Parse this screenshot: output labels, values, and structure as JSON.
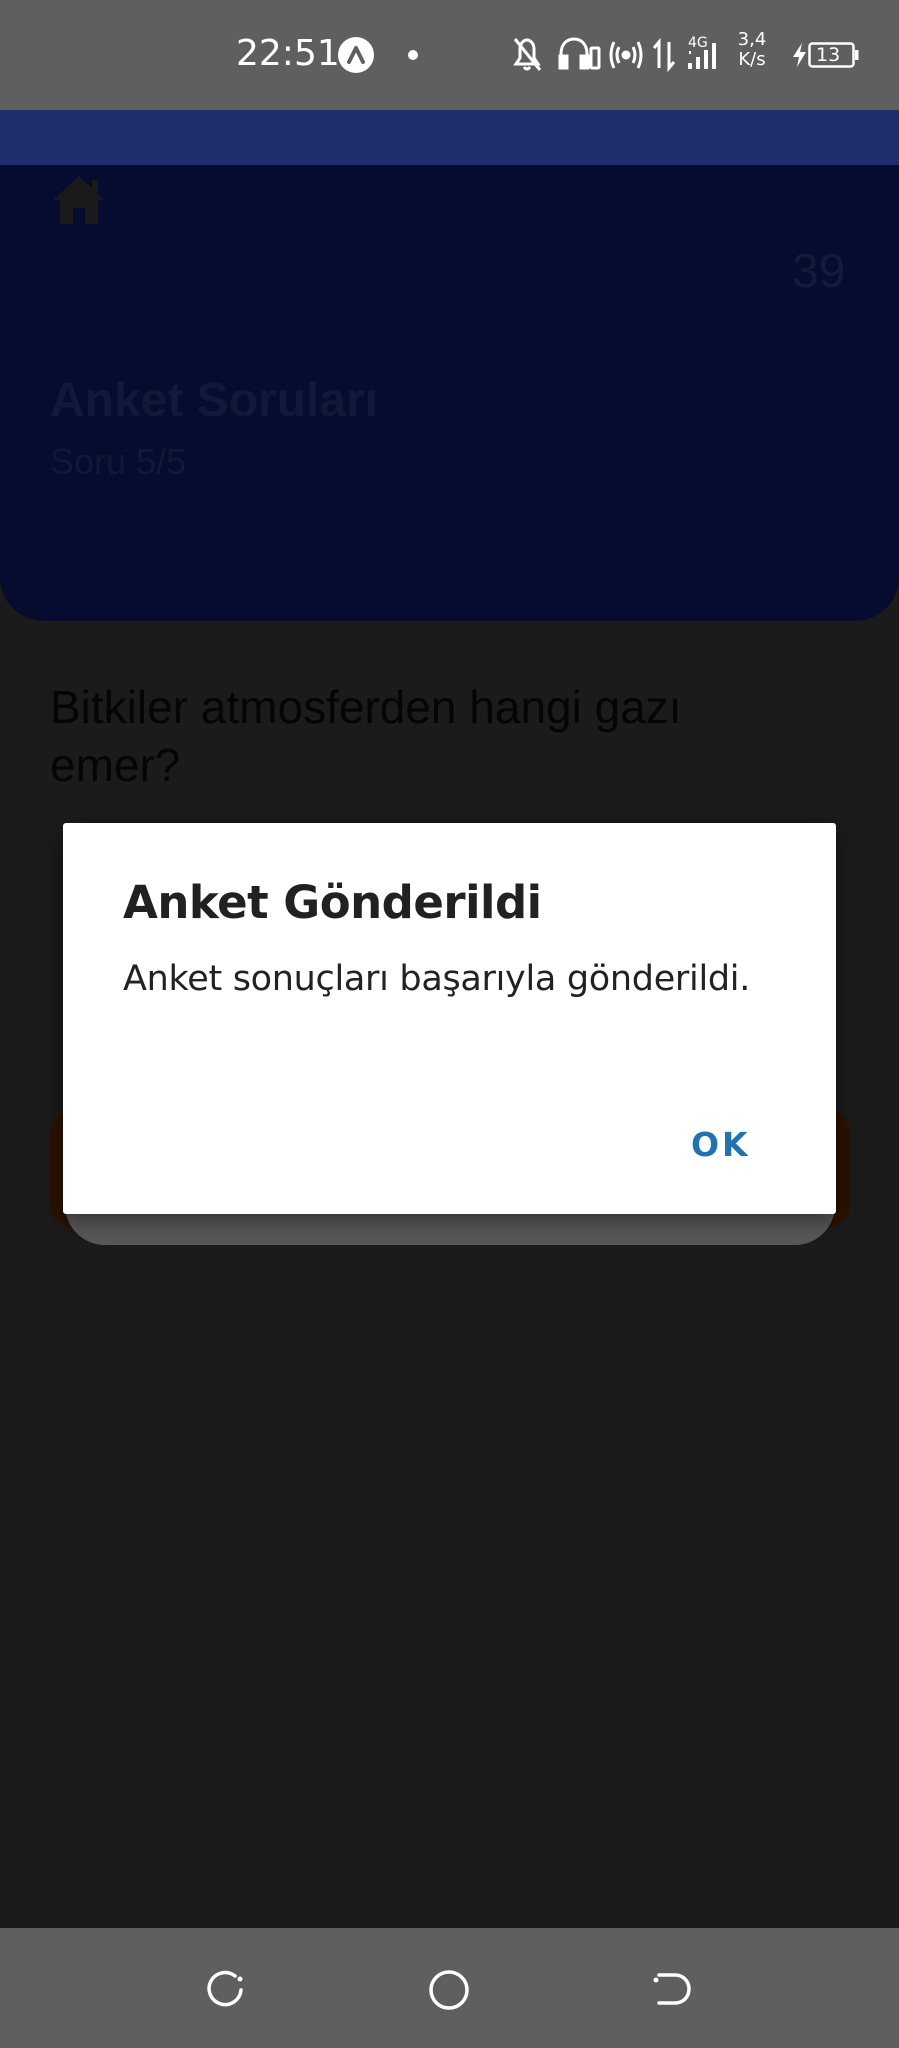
{
  "status_bar": {
    "time": "22:51",
    "network_type": "4G",
    "speed_value": "3,4",
    "speed_unit": "K/s",
    "battery_level": "13",
    "icons": [
      "app-notification-icon",
      "dot-icon",
      "bell-off-icon",
      "headphones-battery-icon",
      "hotspot-icon",
      "data-arrows-icon",
      "signal-icon",
      "charging-icon",
      "battery-icon"
    ]
  },
  "app": {
    "counter": "39",
    "title": "Anket Soruları",
    "subtitle": "Soru 5/5",
    "question": "Bitkiler atmosferden hangi gazı emer?"
  },
  "dialog": {
    "title": "Anket Gönderildi",
    "message": "Anket sonuçları başarıyla gönderildi.",
    "ok_label": "OK"
  },
  "nav_bar": {
    "icons": [
      "recent-apps-icon",
      "home-icon",
      "back-icon"
    ]
  },
  "colors": {
    "header": "#060b30",
    "topbar": "#1f2d6a",
    "dialog_button": "#1e73b0",
    "scrim_background": "#1b1b1b"
  }
}
